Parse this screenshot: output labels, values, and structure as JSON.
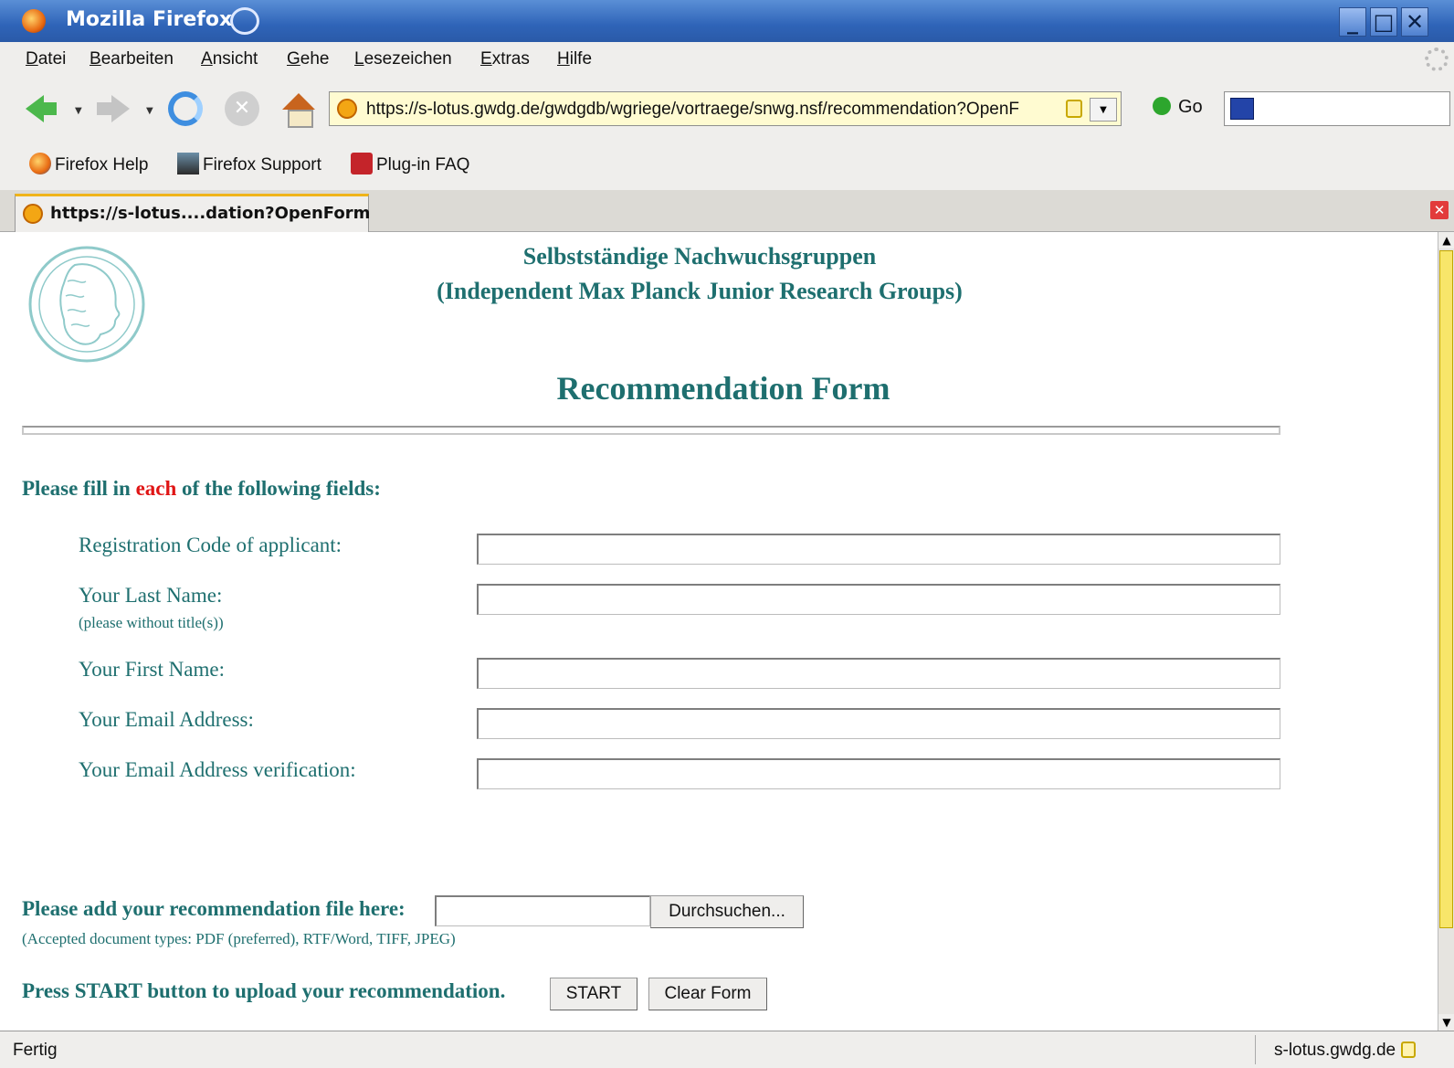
{
  "window": {
    "title": "Mozilla Firefox"
  },
  "menu": [
    "Datei",
    "Bearbeiten",
    "Ansicht",
    "Gehe",
    "Lesezeichen",
    "Extras",
    "Hilfe"
  ],
  "navbar": {
    "url": "https://s-lotus.gwdg.de/gwdgdb/wgriege/vortraege/snwg.nsf/recommendation?OpenF",
    "go_label": "Go"
  },
  "bookmarks": [
    "Firefox Help",
    "Firefox Support",
    "Plug-in FAQ"
  ],
  "tab": {
    "label": "https://s-lotus....dation?OpenForm"
  },
  "page": {
    "header_line1": "Selbstständige Nachwuchsgruppen",
    "header_line2": "(Independent Max Planck Junior Research Groups)",
    "title": "Recommendation Form",
    "instruction_pre": "Please fill in ",
    "instruction_emph": "each",
    "instruction_post": " of the following fields:",
    "fields": [
      {
        "label": "Registration Code of applicant:",
        "value": ""
      },
      {
        "label": "Your Last Name:",
        "sub": "(please without title(s))",
        "value": ""
      },
      {
        "label": "Your First Name:",
        "value": ""
      },
      {
        "label": "Your Email Address:",
        "value": ""
      },
      {
        "label": "Your Email Address verification:",
        "value": ""
      }
    ],
    "file_label": "Please add your recommendation file here:",
    "browse_button": "Durchsuchen...",
    "file_types": "(Accepted document types: PDF (preferred), RTF/Word, TIFF, JPEG)",
    "start_label": "Press START button to upload your recommendation.",
    "start_button": "START",
    "clear_button": "Clear Form"
  },
  "status": {
    "text": "Fertig",
    "host": "s-lotus.gwdg.de"
  },
  "colors": {
    "brand_teal": "#1e6f6f",
    "emphasis_red": "#e01515",
    "titlebar_blue": "#2f64b8",
    "scroll_thumb": "#f8e66a"
  }
}
